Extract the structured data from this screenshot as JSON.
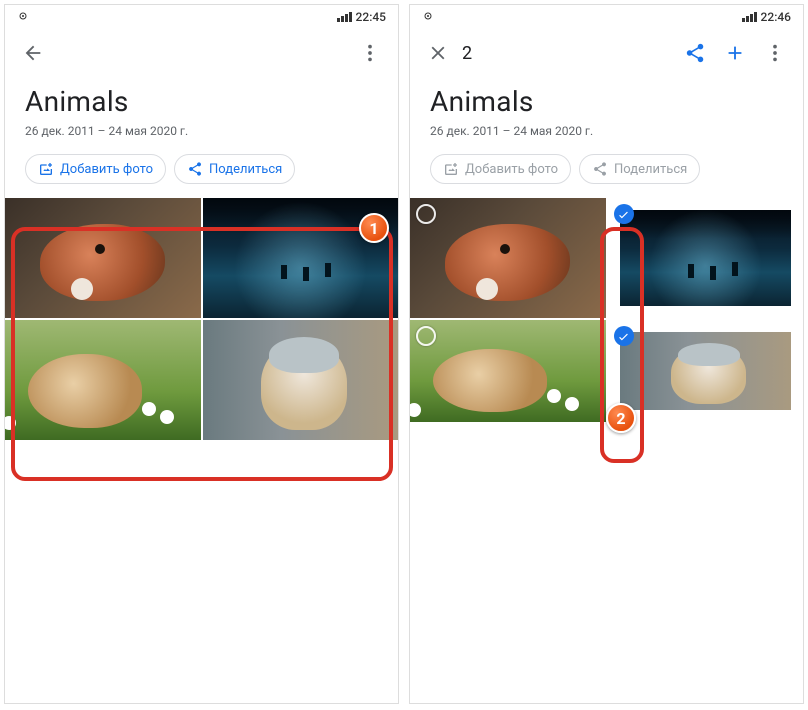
{
  "left": {
    "status_time": "22:45",
    "album_title": "Animals",
    "album_dates": "26 дек. 2011 – 24 мая 2020 г.",
    "chip_add": "Добавить фото",
    "chip_share": "Поделиться",
    "callout": "1",
    "photos": [
      {
        "name": "red-panda",
        "selected": false
      },
      {
        "name": "deer-night",
        "selected": false
      },
      {
        "name": "guinea-pig",
        "selected": false
      },
      {
        "name": "dog-costume",
        "selected": false
      }
    ]
  },
  "right": {
    "status_time": "22:46",
    "selection_count": "2",
    "album_title": "Animals",
    "album_dates": "26 дек. 2011 – 24 мая 2020 г.",
    "chip_add": "Добавить фото",
    "chip_share": "Поделиться",
    "callout": "2",
    "photos": [
      {
        "name": "red-panda",
        "selected": false
      },
      {
        "name": "deer-night",
        "selected": true
      },
      {
        "name": "guinea-pig",
        "selected": false
      },
      {
        "name": "dog-costume",
        "selected": true
      }
    ]
  },
  "icons": {
    "back": "back-icon",
    "close": "close-icon",
    "more": "more-vert-icon",
    "share": "share-icon",
    "plus": "plus-icon",
    "add_photo": "add-photo-icon"
  }
}
